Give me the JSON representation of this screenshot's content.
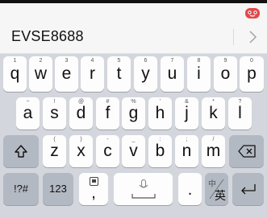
{
  "toolbar": {
    "toggle_icon": "keyboard-collapse-icon"
  },
  "candidate_bar": {
    "text": "EVSE8688",
    "more_icon": "chevron-right-icon"
  },
  "keyboard": {
    "row1": [
      {
        "letter": "q",
        "hint": "1"
      },
      {
        "letter": "w",
        "hint": "2"
      },
      {
        "letter": "e",
        "hint": "3"
      },
      {
        "letter": "r",
        "hint": "4"
      },
      {
        "letter": "t",
        "hint": "5"
      },
      {
        "letter": "y",
        "hint": "6"
      },
      {
        "letter": "u",
        "hint": "7"
      },
      {
        "letter": "i",
        "hint": "8"
      },
      {
        "letter": "o",
        "hint": "9"
      },
      {
        "letter": "p",
        "hint": "0"
      }
    ],
    "row2": [
      {
        "letter": "a",
        "hint": "~"
      },
      {
        "letter": "s",
        "hint": "!"
      },
      {
        "letter": "d",
        "hint": "@"
      },
      {
        "letter": "f",
        "hint": "#"
      },
      {
        "letter": "g",
        "hint": "%"
      },
      {
        "letter": "h",
        "hint": "'"
      },
      {
        "letter": "j",
        "hint": "&"
      },
      {
        "letter": "k",
        "hint": "*"
      },
      {
        "letter": "l",
        "hint": "?"
      }
    ],
    "row3": [
      {
        "letter": "z",
        "hint": "("
      },
      {
        "letter": "x",
        "hint": ")"
      },
      {
        "letter": "c",
        "hint": "-"
      },
      {
        "letter": "v",
        "hint": "_"
      },
      {
        "letter": "b",
        "hint": ":"
      },
      {
        "letter": "n",
        "hint": ";"
      },
      {
        "letter": "m",
        "hint": "/"
      }
    ],
    "symbols_label": "!?#",
    "numbers_label": "123",
    "comma_label": ",",
    "period_label": ".",
    "lang_top": "中",
    "lang_bottom": "英",
    "colors": {
      "key": "#fdfdfd",
      "function_key": "#b3b9c2",
      "background": "#d3d6dc"
    }
  }
}
